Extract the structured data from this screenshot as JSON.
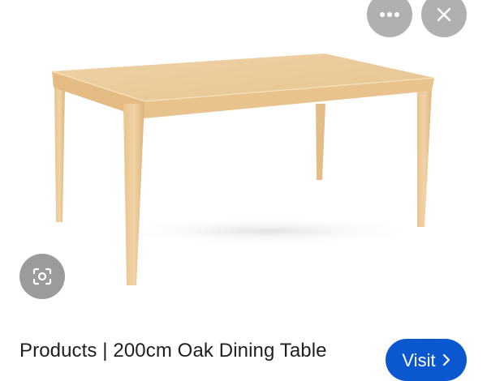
{
  "result": {
    "title": "Products | 200cm Oak Dining Table",
    "visit_label": "Visit"
  },
  "icons": {
    "more": "more-horizontal-icon",
    "close": "close-icon",
    "lens": "lens-search-icon",
    "visit_arrow": "chevron-right-icon"
  },
  "colors": {
    "wood_light": "#EBCB9B",
    "wood_mid": "#E3BC85",
    "overlay_button": "#969696",
    "visit_button": "#0B57D0"
  }
}
